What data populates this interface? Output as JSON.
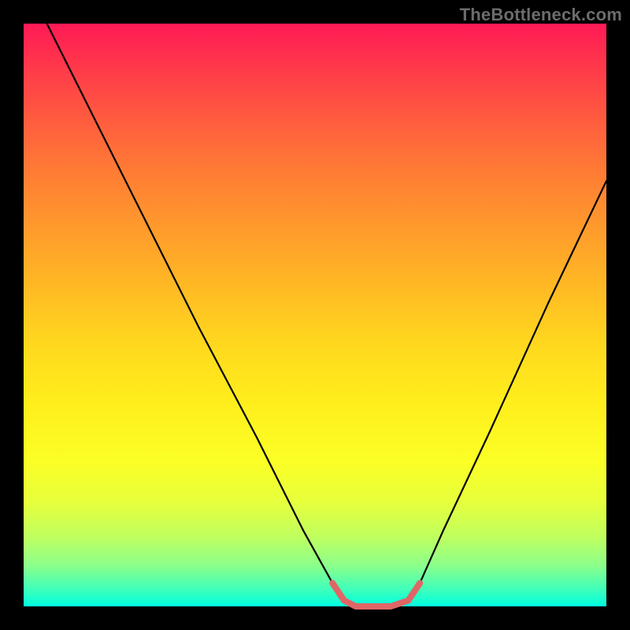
{
  "watermark": "TheBottleneck.com",
  "chart_data": {
    "type": "line",
    "title": "",
    "xlabel": "",
    "ylabel": "",
    "xlim": [
      0,
      100
    ],
    "ylim": [
      0,
      100
    ],
    "background": "rainbow-vertical-gradient",
    "series": [
      {
        "name": "bottleneck-curve",
        "color": "#000000",
        "x": [
          4,
          10,
          20,
          30,
          40,
          48,
          53,
          55,
          57,
          60,
          63,
          66,
          68,
          72,
          80,
          90,
          100
        ],
        "y": [
          100,
          88,
          68,
          48,
          29,
          13,
          4,
          1,
          0,
          0,
          0,
          1,
          4,
          13,
          30,
          52,
          73
        ]
      },
      {
        "name": "optimal-band",
        "color": "#e06666",
        "stroke_width": 8,
        "x": [
          53,
          55,
          57,
          60,
          63,
          66,
          68
        ],
        "y": [
          4,
          1,
          0,
          0,
          0,
          1,
          4
        ]
      }
    ],
    "annotations": []
  }
}
